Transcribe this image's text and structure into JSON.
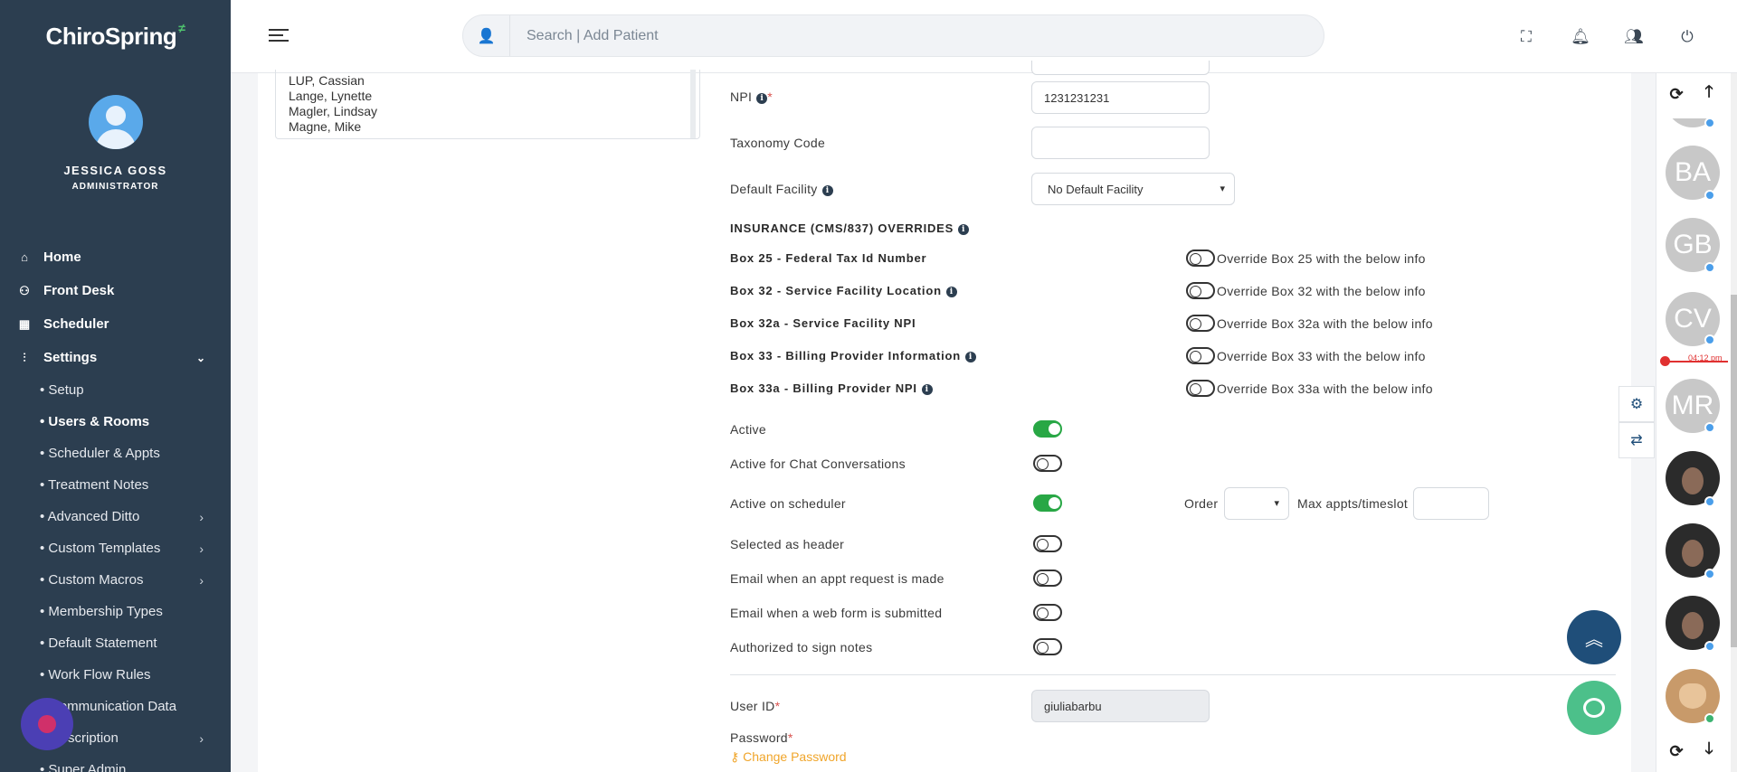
{
  "sidebar": {
    "logo": "ChiroSpring",
    "user_name": "JESSICA GOSS",
    "user_role": "ADMINISTRATOR",
    "nav": [
      {
        "label": "Home",
        "icon": "home-icon"
      },
      {
        "label": "Front Desk",
        "icon": "user-check-icon"
      },
      {
        "label": "Scheduler",
        "icon": "calendar-icon"
      },
      {
        "label": "Settings",
        "icon": "sliders-icon"
      }
    ],
    "sub": [
      {
        "label": "• Setup"
      },
      {
        "label": "• Users & Rooms"
      },
      {
        "label": "• Scheduler & Appts"
      },
      {
        "label": "• Treatment Notes"
      },
      {
        "label": "• Advanced Ditto"
      },
      {
        "label": "• Custom Templates"
      },
      {
        "label": "• Custom Macros"
      },
      {
        "label": "• Membership Types"
      },
      {
        "label": "• Default Statement"
      },
      {
        "label": "• Work Flow Rules"
      },
      {
        "label": "Communication Data"
      },
      {
        "label": "scription"
      },
      {
        "label": "• Super Admin"
      }
    ]
  },
  "topbar": {
    "search_placeholder": "Search | Add Patient"
  },
  "userlist": [
    "LUP, Cassian",
    "Lange, Lynette",
    "Magler, Lindsay",
    "Magne, Mike"
  ],
  "form": {
    "npi_label": "NPI",
    "npi_value": "1231231231",
    "taxonomy_label": "Taxonomy Code",
    "taxonomy_value": "",
    "facility_label": "Default Facility",
    "facility_value": "No Default Facility",
    "overrides_heading": "INSURANCE (CMS/837) OVERRIDES",
    "overrides": [
      {
        "label": "Box 25 - Federal Tax Id Number",
        "toggle_label": "Override Box 25 with the below info",
        "info": false
      },
      {
        "label": "Box 32 - Service Facility Location",
        "toggle_label": "Override Box 32 with the below info",
        "info": true
      },
      {
        "label": "Box 32a - Service Facility NPI",
        "toggle_label": "Override Box 32a with the below info",
        "info": false
      },
      {
        "label": "Box 33 - Billing Provider Information",
        "toggle_label": "Override Box 33 with the below info",
        "info": true
      },
      {
        "label": "Box 33a - Billing Provider NPI",
        "toggle_label": "Override Box 33a with the below info",
        "info": true
      }
    ],
    "switches": [
      {
        "label": "Active",
        "on": true
      },
      {
        "label": "Active for Chat Conversations",
        "on": false
      },
      {
        "label": "Active on scheduler",
        "on": true
      },
      {
        "label": "Selected as header",
        "on": false
      },
      {
        "label": "Email when an appt request is made",
        "on": false
      },
      {
        "label": "Email when a web form is submitted",
        "on": false
      },
      {
        "label": "Authorized to sign notes",
        "on": false
      }
    ],
    "order_label": "Order",
    "max_label": "Max appts/timeslot",
    "userid_label": "User ID",
    "userid_value": "giuliabarbu",
    "password_label": "Password",
    "change_password": "Change Password",
    "required_mark": "*"
  },
  "rail": {
    "providers": [
      {
        "initials": "BA"
      },
      {
        "initials": "GB"
      },
      {
        "initials": "CV"
      },
      {
        "initials": "MR"
      }
    ],
    "time": "04:12 pm"
  }
}
